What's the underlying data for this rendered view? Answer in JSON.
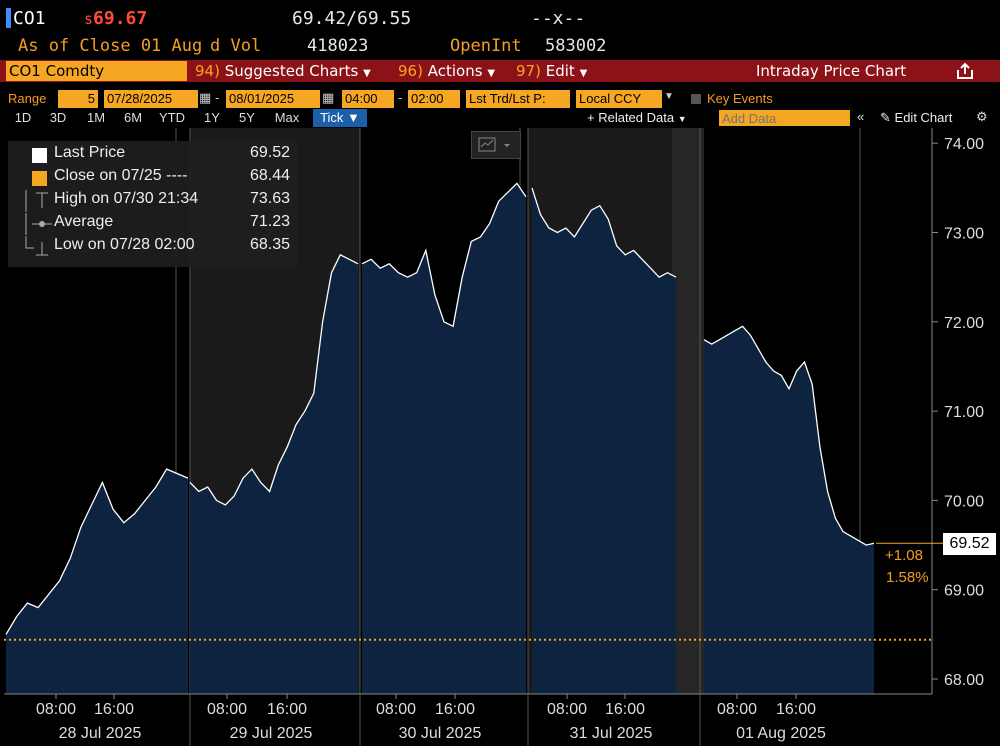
{
  "header": {
    "ticker": "CO1",
    "price_prefix": "s",
    "price": "69.67",
    "bid_ask": "69.42/69.55",
    "change_placeholder": "--x--",
    "as_of": "As of Close 01 Aug",
    "vol_label": "d Vol",
    "vol_value": "418023",
    "openint_label": "OpenInt",
    "openint_value": "583002"
  },
  "toolbar": {
    "security": "CO1 Comdty",
    "menu1_num": "94)",
    "menu1_label": "Suggested Charts",
    "menu2_num": "96)",
    "menu2_label": "Actions",
    "menu3_num": "97)",
    "menu3_label": "Edit",
    "title": "Intraday Price Chart"
  },
  "range": {
    "label": "Range",
    "num": "5",
    "start_date": "07/28/2025",
    "end_date": "08/01/2025",
    "start_time": "04:00",
    "end_time": "02:00",
    "price_type": "Lst Trd/Lst P:",
    "currency": "Local CCY",
    "key_events": "Key Events"
  },
  "periods": [
    "1D",
    "3D",
    "1M",
    "6M",
    "YTD",
    "1Y",
    "5Y",
    "Max"
  ],
  "active_period": "Tick",
  "related_data": "+ Related Data",
  "add_data_placeholder": "Add Data",
  "edit_chart": "Edit Chart",
  "legend": {
    "last_label": "Last Price",
    "last_value": "69.52",
    "close_label": "Close on 07/25 ----",
    "close_value": "68.44",
    "high_label": "High on 07/30 21:34",
    "high_value": "73.63",
    "avg_label": "Average",
    "avg_value": "71.23",
    "low_label": "Low on 07/28 02:00",
    "low_value": "68.35"
  },
  "callouts": {
    "last_price": "69.52",
    "change": "+1.08",
    "change_pct": "1.58%"
  },
  "colors": {
    "accent": "#f5a623",
    "bar": "#8b1216",
    "area": "#0e2340",
    "line": "#ffffff",
    "close_line": "#f5a623"
  },
  "chart_data": {
    "type": "area",
    "ylim": [
      68.0,
      74.0
    ],
    "y_ticks": [
      "68.00",
      "69.00",
      "70.00",
      "71.00",
      "72.00",
      "73.00",
      "74.00"
    ],
    "x_tick_labels": [
      {
        "time": "08:00",
        "day": "28 Jul 2025"
      },
      {
        "time": "16:00",
        "day": ""
      },
      {
        "time": "08:00",
        "day": "29 Jul 2025"
      },
      {
        "time": "16:00",
        "day": ""
      },
      {
        "time": "08:00",
        "day": "30 Jul 2025"
      },
      {
        "time": "16:00",
        "day": ""
      },
      {
        "time": "08:00",
        "day": "31 Jul 2025"
      },
      {
        "time": "16:00",
        "day": ""
      },
      {
        "time": "08:00",
        "day": "01 Aug 2025"
      },
      {
        "time": "16:00",
        "day": ""
      }
    ],
    "reference_close": 68.44,
    "days": [
      {
        "day": "28 Jul 2025",
        "values": [
          68.5,
          68.7,
          68.85,
          68.8,
          68.95,
          69.1,
          69.35,
          69.7,
          69.95,
          70.2,
          69.9,
          69.75,
          69.85,
          70.0,
          70.15,
          70.35,
          70.3,
          70.25
        ]
      },
      {
        "day": "29 Jul 2025",
        "values": [
          70.2,
          70.1,
          70.15,
          70.0,
          69.95,
          70.05,
          70.25,
          70.35,
          70.2,
          70.1,
          70.4,
          70.6,
          70.85,
          71.0,
          71.2,
          72.0,
          72.55,
          72.75,
          72.7,
          72.65
        ]
      },
      {
        "day": "30 Jul 2025",
        "values": [
          72.65,
          72.7,
          72.6,
          72.65,
          72.55,
          72.5,
          72.55,
          72.8,
          72.3,
          72.0,
          71.95,
          72.5,
          72.9,
          72.95,
          73.1,
          73.35,
          73.45,
          73.55,
          73.4
        ]
      },
      {
        "day": "31 Jul 2025",
        "values": [
          73.5,
          73.2,
          73.05,
          73.0,
          73.05,
          72.95,
          73.1,
          73.25,
          73.3,
          73.15,
          72.85,
          72.75,
          72.8,
          72.7,
          72.6,
          72.5,
          72.55,
          72.5
        ]
      },
      {
        "day": "01 Aug 2025",
        "values": [
          71.8,
          71.75,
          71.8,
          71.85,
          71.9,
          71.95,
          71.85,
          71.7,
          71.55,
          71.45,
          71.4,
          71.25,
          71.45,
          71.55,
          71.3,
          70.6,
          70.1,
          69.8,
          69.65,
          69.6,
          69.55,
          69.5,
          69.52
        ]
      }
    ],
    "stats": {
      "last": 69.52,
      "close_prev": 68.44,
      "high": 73.63,
      "average": 71.23,
      "low": 68.35
    }
  }
}
